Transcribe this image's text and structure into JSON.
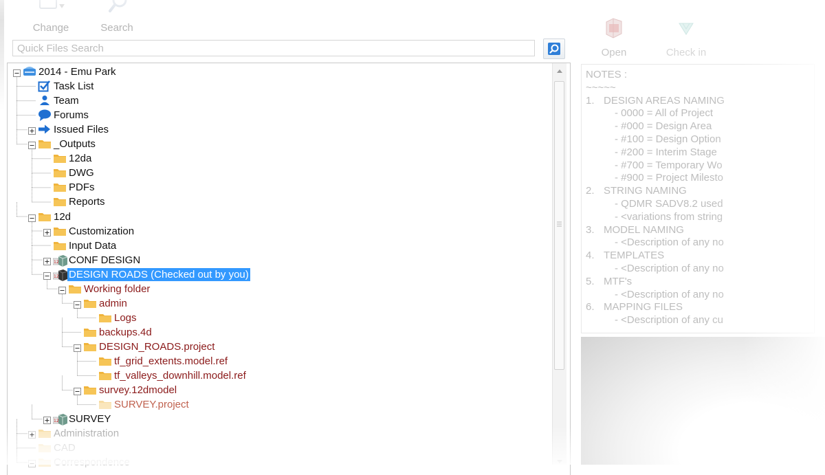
{
  "toolbar": {
    "change_label": "Change",
    "search_label": "Search"
  },
  "quick_search": {
    "placeholder": "Quick Files Search"
  },
  "tree": {
    "nodes": [
      {
        "label": "2014 - Emu Park",
        "icon": "project-server-icon",
        "expander": "minus",
        "style": "normal"
      },
      {
        "label": "Task List",
        "icon": "checkbox-icon",
        "expander": "none",
        "style": "normal"
      },
      {
        "label": "Team",
        "icon": "person-icon",
        "expander": "none",
        "style": "normal"
      },
      {
        "label": "Forums",
        "icon": "speech-bubble-icon",
        "expander": "none",
        "style": "normal"
      },
      {
        "label": "Issued Files",
        "icon": "arrow-right-icon",
        "expander": "plus",
        "style": "normal"
      },
      {
        "label": "_Outputs",
        "icon": "folder-icon",
        "expander": "minus",
        "style": "normal"
      },
      {
        "label": "12da",
        "icon": "folder-icon",
        "expander": "none",
        "style": "normal"
      },
      {
        "label": "DWG",
        "icon": "folder-icon",
        "expander": "none",
        "style": "normal"
      },
      {
        "label": "PDFs",
        "icon": "folder-icon",
        "expander": "none",
        "style": "normal"
      },
      {
        "label": "Reports",
        "icon": "folder-icon",
        "expander": "none",
        "style": "normal"
      },
      {
        "label": "12d",
        "icon": "folder-icon",
        "expander": "minus",
        "style": "normal"
      },
      {
        "label": "Customization",
        "icon": "folder-icon",
        "expander": "plus",
        "style": "normal"
      },
      {
        "label": "Input Data",
        "icon": "folder-icon",
        "expander": "none",
        "style": "normal"
      },
      {
        "label": "CONF DESIGN",
        "icon": "12d-project-icon",
        "expander": "plus",
        "style": "normal"
      },
      {
        "label": "DESIGN ROADS (Checked out by you)",
        "icon": "12d-project-checked-out-icon",
        "expander": "minus",
        "style": "selected"
      },
      {
        "label": "Working folder",
        "icon": "folder-icon",
        "expander": "minus",
        "style": "red"
      },
      {
        "label": "admin",
        "icon": "folder-icon",
        "expander": "minus",
        "style": "red"
      },
      {
        "label": "Logs",
        "icon": "folder-icon",
        "expander": "none",
        "style": "red"
      },
      {
        "label": "backups.4d",
        "icon": "folder-icon",
        "expander": "none",
        "style": "red"
      },
      {
        "label": "DESIGN_ROADS.project",
        "icon": "folder-icon",
        "expander": "minus",
        "style": "red"
      },
      {
        "label": "tf_grid_extents.model.ref",
        "icon": "folder-icon",
        "expander": "none",
        "style": "red"
      },
      {
        "label": "tf_valleys_downhill.model.ref",
        "icon": "folder-icon",
        "expander": "none",
        "style": "red"
      },
      {
        "label": "survey.12dmodel",
        "icon": "folder-icon",
        "expander": "minus",
        "style": "red"
      },
      {
        "label": "SURVEY.project",
        "icon": "folder-icon",
        "expander": "none",
        "style": "red-faint"
      },
      {
        "label": "SURVEY",
        "icon": "12d-project-icon",
        "expander": "plus",
        "style": "normal"
      },
      {
        "label": "Administration",
        "icon": "folder-icon",
        "expander": "plus",
        "style": "faint"
      },
      {
        "label": "CAD",
        "icon": "folder-icon",
        "expander": "none",
        "style": "fainter"
      },
      {
        "label": "Correspondence",
        "icon": "folder-icon",
        "expander": "minus",
        "style": "fainter"
      }
    ]
  },
  "right_toolbar": {
    "open_label": "Open",
    "checkin_label": "Check in"
  },
  "notes": {
    "title": "NOTES :",
    "underline": "~~~~~",
    "lines": [
      {
        "type": "head",
        "num": "1.",
        "text": "DESIGN AREAS NAMING"
      },
      {
        "type": "sub",
        "text": "- 0000 = All of Project"
      },
      {
        "type": "sub",
        "text": "- #000 = Design Area"
      },
      {
        "type": "sub",
        "text": "- #100 = Design Option"
      },
      {
        "type": "sub",
        "text": "- #200 = Interim Stage"
      },
      {
        "type": "sub",
        "text": "- #700 = Temporary Wo"
      },
      {
        "type": "sub",
        "text": "- #900 = Project Milesto"
      },
      {
        "type": "head",
        "num": "2.",
        "text": "STRING NAMING"
      },
      {
        "type": "sub",
        "text": "- QDMR SADV8.2 used"
      },
      {
        "type": "sub",
        "text": "- <variations from string"
      },
      {
        "type": "head",
        "num": "3.",
        "text": "MODEL NAMING"
      },
      {
        "type": "sub",
        "text": "- <Description of any no"
      },
      {
        "type": "head",
        "num": "4.",
        "text": "TEMPLATES"
      },
      {
        "type": "sub",
        "text": "- <Description of any no"
      },
      {
        "type": "head",
        "num": "5.",
        "text": "MTF's"
      },
      {
        "type": "sub",
        "text": "- <Description of any no"
      },
      {
        "type": "head",
        "num": "6.",
        "text": "MAPPING FILES"
      },
      {
        "type": "sub",
        "text": "- <Description of any cu"
      }
    ]
  },
  "colors": {
    "folder": "#f0b43c",
    "selected_bg": "#3399ff",
    "checked_out_text": "#8b1a1a",
    "icon_blue": "#1f6fd1"
  }
}
